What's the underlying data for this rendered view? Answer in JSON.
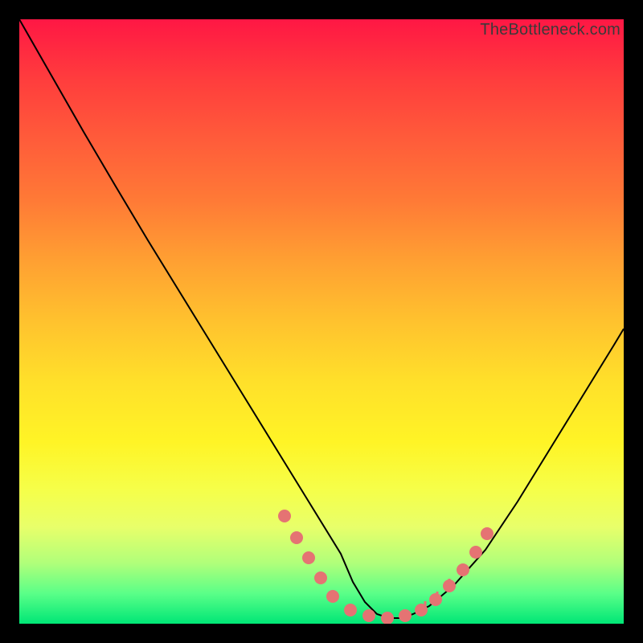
{
  "attribution": "TheBottleneck.com",
  "chart_data": {
    "type": "line",
    "title": "",
    "xlabel": "",
    "ylabel": "",
    "xlim": [
      0,
      752
    ],
    "ylim": [
      0,
      752
    ],
    "series": [
      {
        "name": "bottleneck-curve",
        "x": [
          0,
          40,
          80,
          120,
          160,
          200,
          240,
          280,
          320,
          360,
          400,
          415,
          430,
          445,
          460,
          475,
          490,
          510,
          540,
          580,
          620,
          660,
          700,
          740,
          752
        ],
        "y": [
          0,
          70,
          140,
          208,
          275,
          340,
          405,
          470,
          535,
          600,
          665,
          700,
          725,
          740,
          745,
          745,
          740,
          730,
          705,
          660,
          600,
          535,
          470,
          405,
          385
        ]
      }
    ],
    "markers": {
      "name": "highlight-dots",
      "color": "#e57373",
      "points": [
        {
          "x": 330,
          "y": 618
        },
        {
          "x": 345,
          "y": 645
        },
        {
          "x": 360,
          "y": 670
        },
        {
          "x": 375,
          "y": 695
        },
        {
          "x": 390,
          "y": 718
        },
        {
          "x": 412,
          "y": 735
        },
        {
          "x": 435,
          "y": 742
        },
        {
          "x": 458,
          "y": 745
        },
        {
          "x": 480,
          "y": 742
        },
        {
          "x": 500,
          "y": 735
        },
        {
          "x": 518,
          "y": 722
        },
        {
          "x": 535,
          "y": 705
        },
        {
          "x": 552,
          "y": 685
        },
        {
          "x": 568,
          "y": 663
        },
        {
          "x": 582,
          "y": 640
        }
      ]
    },
    "marker_ticks": {
      "name": "highlight-ticks",
      "color": "#e57373",
      "points": [
        {
          "x": 505,
          "y": 730
        },
        {
          "x": 520,
          "y": 718
        },
        {
          "x": 535,
          "y": 702
        },
        {
          "x": 550,
          "y": 684
        },
        {
          "x": 565,
          "y": 664
        }
      ]
    }
  }
}
